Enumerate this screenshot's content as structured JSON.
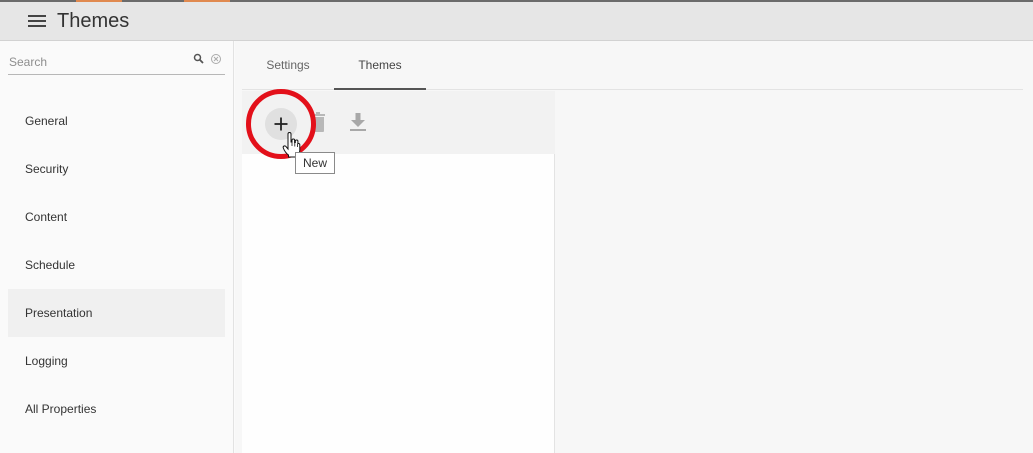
{
  "header": {
    "title": "Themes",
    "menu_icon": "hamburger-menu-icon"
  },
  "sidebar": {
    "search": {
      "placeholder": "Search",
      "value": ""
    },
    "items": [
      {
        "label": "General",
        "active": false
      },
      {
        "label": "Security",
        "active": false
      },
      {
        "label": "Content",
        "active": false
      },
      {
        "label": "Schedule",
        "active": false
      },
      {
        "label": "Presentation",
        "active": true
      },
      {
        "label": "Logging",
        "active": false
      },
      {
        "label": "All Properties",
        "active": false
      }
    ]
  },
  "tabs": [
    {
      "label": "Settings",
      "active": false
    },
    {
      "label": "Themes",
      "active": true
    }
  ],
  "toolbar": {
    "new_tooltip": "New",
    "icons": [
      "plus-icon",
      "trash-icon",
      "download-icon"
    ]
  },
  "colors": {
    "highlight": "#e3101a",
    "accent": "#e0894f",
    "header_bg": "#e6e6e6"
  }
}
